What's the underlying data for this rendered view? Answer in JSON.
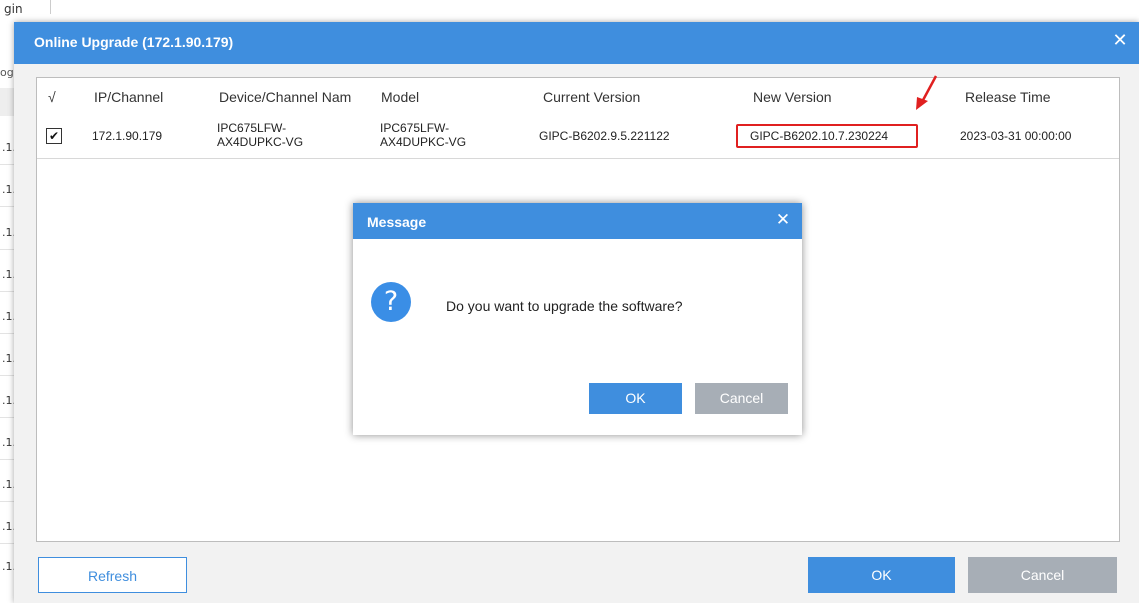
{
  "background": {
    "tab_fragment": "gin",
    "header_fragment": "og",
    "row_fragment": ".1."
  },
  "dialog": {
    "title": "Online Upgrade (172.1.90.179)",
    "close_glyph": "✕",
    "columns": {
      "check": "√",
      "ip": "IP/Channel",
      "device": "Device/Channel Nam",
      "model": "Model",
      "current": "Current Version",
      "new": "New Version",
      "release": "Release Time"
    },
    "rows": [
      {
        "checked": "✔",
        "ip": "172.1.90.179",
        "device_line1": "IPC675LFW-",
        "device_line2": "AX4DUPKC-VG",
        "model_line1": "IPC675LFW-",
        "model_line2": "AX4DUPKC-VG",
        "current": "GIPC-B6202.9.5.221122",
        "new": "GIPC-B6202.10.7.230224",
        "release": "2023-03-31 00:00:00"
      }
    ],
    "buttons": {
      "refresh": "Refresh",
      "ok": "OK",
      "cancel": "Cancel"
    }
  },
  "message": {
    "title": "Message",
    "close_glyph": "✕",
    "icon": "?",
    "text": "Do you want to upgrade the software?",
    "ok": "OK",
    "cancel": "Cancel"
  },
  "colors": {
    "accent": "#3f8ede",
    "highlight": "#e02020",
    "cancel_gray": "#a7aeb6"
  },
  "icons": {
    "close": "close-icon",
    "question": "question-icon",
    "arrow": "annotation-arrow-icon",
    "check": "checkmark-icon"
  }
}
